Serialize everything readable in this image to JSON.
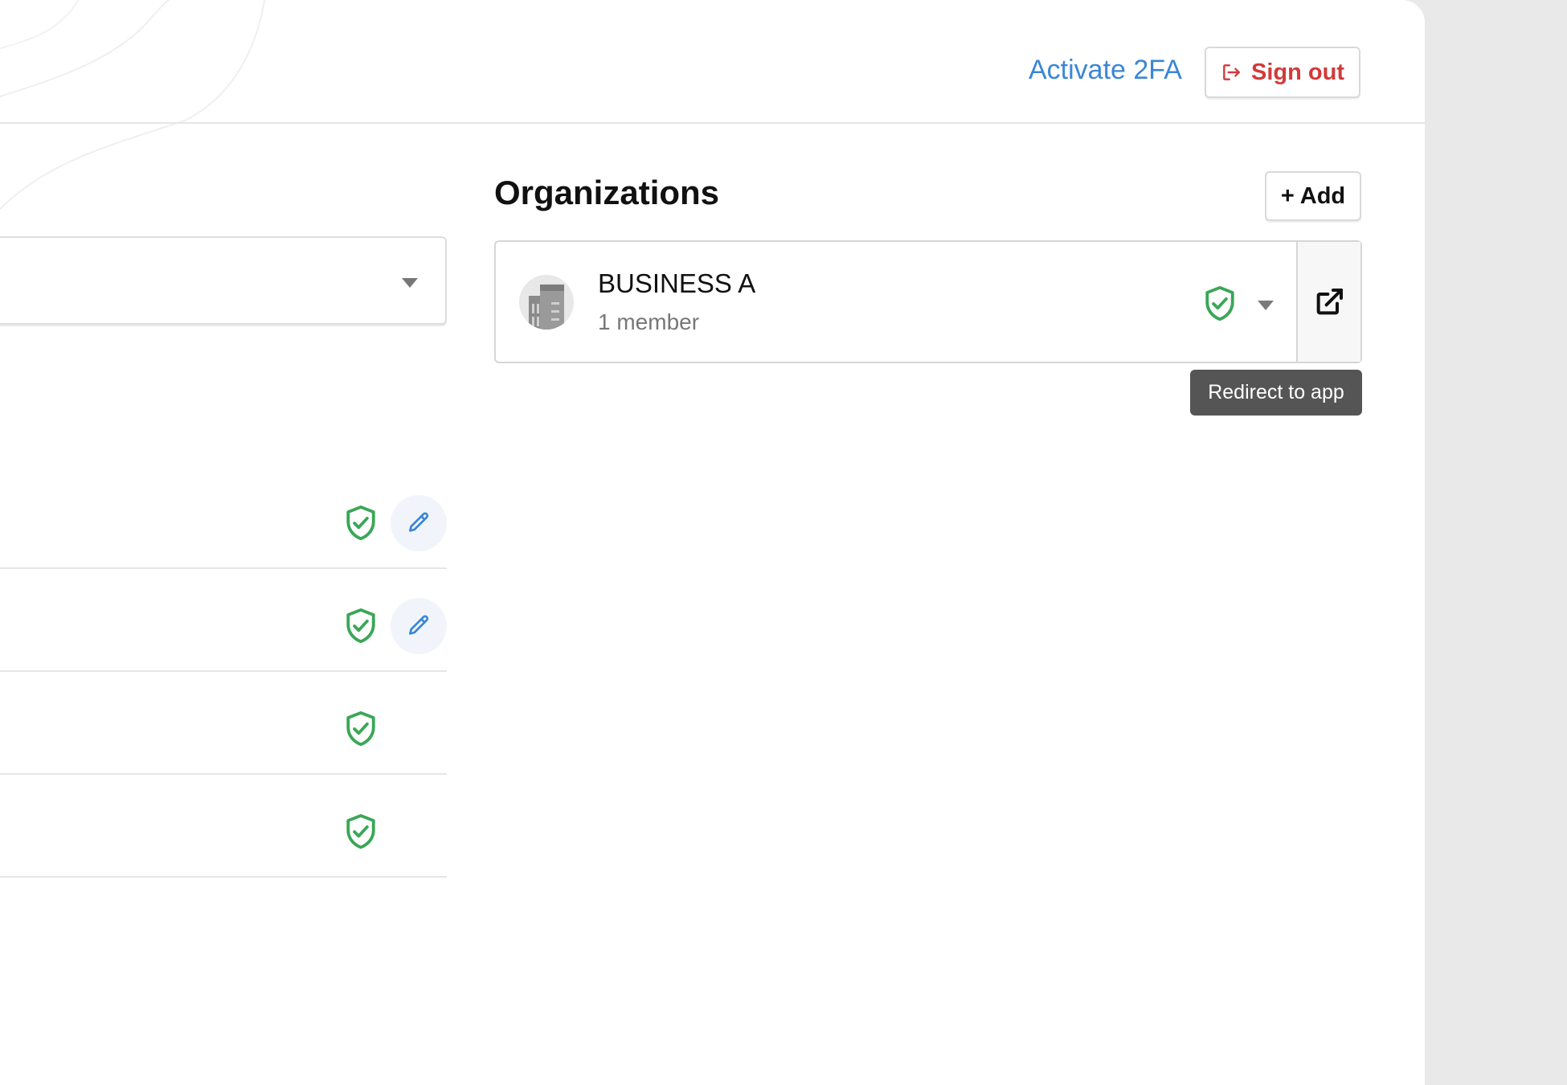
{
  "header": {
    "activate_2fa_label": "Activate 2FA",
    "sign_out_label": "Sign out"
  },
  "organizations": {
    "title": "Organizations",
    "add_label": "+ Add",
    "items": [
      {
        "name": "BUSINESS A",
        "members": "1 member"
      }
    ],
    "redirect_tooltip": "Redirect to app"
  },
  "left_rows": [
    {
      "verified": true,
      "editable": true
    },
    {
      "verified": true,
      "editable": true
    },
    {
      "verified": true,
      "editable": false
    },
    {
      "verified": true,
      "editable": false
    }
  ],
  "colors": {
    "link": "#3a86d6",
    "danger": "#d23a3a",
    "verified": "#3aa757",
    "edit": "#3a86d6",
    "tooltip_bg": "#555555"
  },
  "icons": {
    "sign_out": "sign-out-icon",
    "verified": "shield-check-icon",
    "edit": "pencil-icon",
    "redirect": "external-link-icon",
    "org_avatar": "building-icon",
    "dropdown": "caret-down-icon"
  }
}
